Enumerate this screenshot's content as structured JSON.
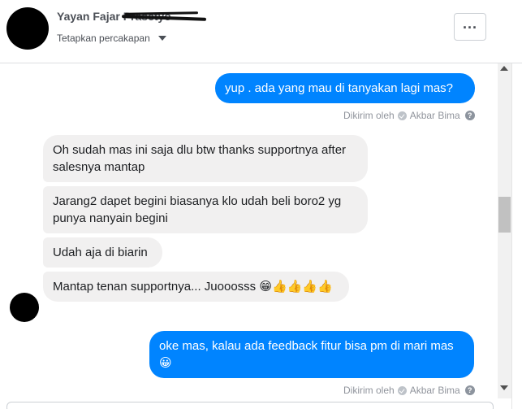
{
  "header": {
    "contact_name": "Yayan Fajar Prasetyo",
    "pin_label": "Tetapkan percakapan",
    "more_label": "..."
  },
  "messages": [
    {
      "direction": "out",
      "text": "yup . ada yang mau di tanyakan lagi mas?"
    },
    {
      "direction": "meta",
      "sent_by": "Dikirim oleh",
      "sender": "Akbar Bima"
    },
    {
      "direction": "in",
      "text": "Oh sudah mas ini saja dlu btw thanks supportnya after salesnya mantap"
    },
    {
      "direction": "in",
      "text": "Jarang2 dapet begini biasanya klo udah beli boro2 yg punya nanyain begini"
    },
    {
      "direction": "in",
      "text": "Udah aja di biarin"
    },
    {
      "direction": "in",
      "text": "Mantap tenan supportnya... Juooosss 😁👍👍👍👍"
    },
    {
      "direction": "out",
      "text": "oke mas, kalau ada feedback fitur bisa pm di mari mas 😀"
    },
    {
      "direction": "meta",
      "sent_by": "Dikirim oleh",
      "sender": "Akbar Bima"
    }
  ],
  "icons": {
    "more": "more-options-icon",
    "caret": "caret-down-icon",
    "seen": "check-circle-icon",
    "help": "question-circle-icon"
  },
  "colors": {
    "outgoing_bubble": "#0084ff",
    "incoming_bubble": "#f1f0f0"
  }
}
